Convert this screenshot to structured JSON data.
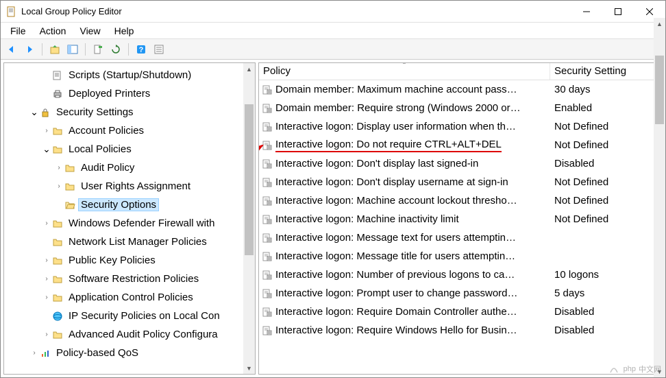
{
  "window": {
    "title": "Local Group Policy Editor"
  },
  "menu": {
    "file": "File",
    "action": "Action",
    "view": "View",
    "help": "Help"
  },
  "tree": {
    "items": [
      {
        "indent": 3,
        "exp": "",
        "icon": "script",
        "label": "Scripts (Startup/Shutdown)"
      },
      {
        "indent": 3,
        "exp": "",
        "icon": "printer",
        "label": "Deployed Printers"
      },
      {
        "indent": 2,
        "exp": "v",
        "icon": "security",
        "label": "Security Settings"
      },
      {
        "indent": 3,
        "exp": ">",
        "icon": "folder",
        "label": "Account Policies"
      },
      {
        "indent": 3,
        "exp": "v",
        "icon": "folder",
        "label": "Local Policies"
      },
      {
        "indent": 4,
        "exp": ">",
        "icon": "folder",
        "label": "Audit Policy"
      },
      {
        "indent": 4,
        "exp": ">",
        "icon": "folder",
        "label": "User Rights Assignment"
      },
      {
        "indent": 4,
        "exp": "",
        "icon": "folder-open",
        "label": "Security Options",
        "selected": true
      },
      {
        "indent": 3,
        "exp": ">",
        "icon": "folder",
        "label": "Windows Defender Firewall with"
      },
      {
        "indent": 3,
        "exp": "",
        "icon": "folder",
        "label": "Network List Manager Policies"
      },
      {
        "indent": 3,
        "exp": ">",
        "icon": "folder",
        "label": "Public Key Policies"
      },
      {
        "indent": 3,
        "exp": ">",
        "icon": "folder",
        "label": "Software Restriction Policies"
      },
      {
        "indent": 3,
        "exp": ">",
        "icon": "folder",
        "label": "Application Control Policies"
      },
      {
        "indent": 3,
        "exp": "",
        "icon": "ipsec",
        "label": "IP Security Policies on Local Con"
      },
      {
        "indent": 3,
        "exp": ">",
        "icon": "folder",
        "label": "Advanced Audit Policy Configura"
      },
      {
        "indent": 2,
        "exp": ">",
        "icon": "qos",
        "label": "Policy-based QoS"
      }
    ]
  },
  "list": {
    "col_policy": "Policy",
    "col_setting": "Security Setting",
    "rows": [
      {
        "policy": "Domain member: Maximum machine account pass…",
        "setting": "30 days"
      },
      {
        "policy": "Domain member: Require strong (Windows 2000 or…",
        "setting": "Enabled"
      },
      {
        "policy": "Interactive logon: Display user information when th…",
        "setting": "Not Defined"
      },
      {
        "policy": "Interactive logon: Do not require CTRL+ALT+DEL",
        "setting": "Not Defined",
        "highlight": true
      },
      {
        "policy": "Interactive logon: Don't display last signed-in",
        "setting": "Disabled"
      },
      {
        "policy": "Interactive logon: Don't display username at sign-in",
        "setting": "Not Defined"
      },
      {
        "policy": "Interactive logon: Machine account lockout thresho…",
        "setting": "Not Defined"
      },
      {
        "policy": "Interactive logon: Machine inactivity limit",
        "setting": "Not Defined"
      },
      {
        "policy": "Interactive logon: Message text for users attemptin…",
        "setting": ""
      },
      {
        "policy": "Interactive logon: Message title for users attemptin…",
        "setting": ""
      },
      {
        "policy": "Interactive logon: Number of previous logons to ca…",
        "setting": "10 logons"
      },
      {
        "policy": "Interactive logon: Prompt user to change password…",
        "setting": "5 days"
      },
      {
        "policy": "Interactive logon: Require Domain Controller authe…",
        "setting": "Disabled"
      },
      {
        "policy": "Interactive logon: Require Windows Hello for Busin…",
        "setting": "Disabled"
      }
    ]
  },
  "watermark": "中文网"
}
